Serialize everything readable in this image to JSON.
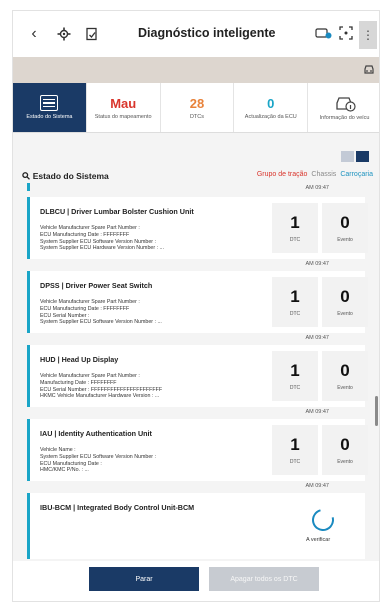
{
  "header": {
    "back_icon": "‹",
    "title": "Diagnóstico inteligente",
    "menu_icon": "⋮"
  },
  "tabs": [
    {
      "value": "",
      "label": "Estado do Sistema"
    },
    {
      "value": "Mau",
      "label": "Status do mapeamento"
    },
    {
      "value": "28",
      "label": "DTCs"
    },
    {
      "value": "0",
      "label": "Actualização da ECU"
    },
    {
      "value": "",
      "label": "Informação do veícu"
    }
  ],
  "section": {
    "search_icon": "⚲",
    "title": "Estado do Sistema",
    "filters": [
      "Grupo de tração",
      "Chassis",
      "Carroçaria"
    ]
  },
  "timestamps": [
    "AM 09:47",
    "AM 09:47",
    "AM 09:47",
    "AM 09:47",
    "AM 09:47"
  ],
  "modules": [
    {
      "name": "DLBCU | Driver Lumbar Bolster Cushion Unit",
      "info": "Vehicle Manufacturer Spare Part Number :\nECU Manufacturing Date : FFFFFFFF\nSystem Supplier ECU Software Version Number :\nSystem Supplier ECU Hardware Version Number : ...",
      "dtc": "1",
      "dtc_label": "DTC",
      "events": "0",
      "events_label": "Evento"
    },
    {
      "name": "DPSS | Driver Power Seat Switch",
      "info": "Vehicle Manufacturer Spare Part Number :\nECU Manufacturing Date : FFFFFFFF\nECU Serial Number :\nSystem Supplier ECU Software Version Number : ...",
      "dtc": "1",
      "dtc_label": "DTC",
      "events": "0",
      "events_label": "Evento"
    },
    {
      "name": "HUD | Head Up Display",
      "info": "Vehicle Manufacturer Spare Part Number :\nManufacturing Date : FFFFFFFF\nECU Serial Number : FFFFFFFFFFFFFFFFFFFFFF\nHKMC Vehicle Manufacturer Hardware Version : ...",
      "dtc": "1",
      "dtc_label": "DTC",
      "events": "0",
      "events_label": "Evento"
    },
    {
      "name": "IAU | Identity Authentication Unit",
      "info": "Vehicle Name :\nSystem Supplier ECU Software Version Number :\nECU Manufacturing Date :\nHMC/KMC P/No. : ...",
      "dtc": "1",
      "dtc_label": "DTC",
      "events": "0",
      "events_label": "Evento"
    },
    {
      "name": "IBU-BCM | Integrated Body Control Unit-BCM",
      "status": "A verificar"
    }
  ],
  "buttons": {
    "stop": "Parar",
    "delete_all": "Apagar todos os DTC"
  },
  "colors": {
    "primary": "#1a3a66",
    "accent": "#1aa5c7",
    "warning": "#d9352c",
    "band": "#ddd6cf"
  }
}
